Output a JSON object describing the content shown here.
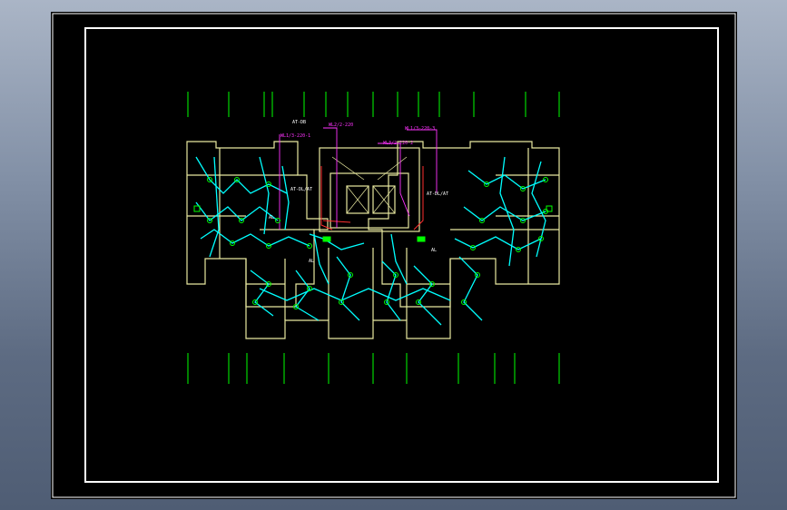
{
  "colors": {
    "background": "#000000",
    "frame": "#ffffff",
    "axis": "#00ff00",
    "wall": "#e8e8a0",
    "wiring": "#00ffff",
    "device": "#00ff00",
    "feeder": "#ff33ff",
    "riser": "#ff3030"
  },
  "panel_labels": [
    {
      "id": "AT-DB",
      "text": "AT-DB",
      "color": "#ffffff"
    },
    {
      "id": "AT-TL",
      "text": "AL",
      "color": "#ffffff"
    },
    {
      "id": "AL-L",
      "text": "AL",
      "color": "#ffffff"
    },
    {
      "id": "AL-R",
      "text": "AL",
      "color": "#ffffff"
    },
    {
      "id": "AT-R",
      "text": "AT-DL/AT",
      "color": "#ffffff"
    },
    {
      "id": "AT-L",
      "text": "AT-DL/AT",
      "color": "#ffffff"
    }
  ],
  "feeder_labels": [
    {
      "id": "f1",
      "text": "WL1/3-220-1",
      "color": "#ff33ff"
    },
    {
      "id": "f2",
      "text": "WL2/2-220",
      "color": "#ff33ff"
    },
    {
      "id": "f3",
      "text": "WL3/2-220-2",
      "color": "#ff33ff"
    },
    {
      "id": "f4",
      "text": "WL1/3-220-3",
      "color": "#ff33ff"
    }
  ]
}
